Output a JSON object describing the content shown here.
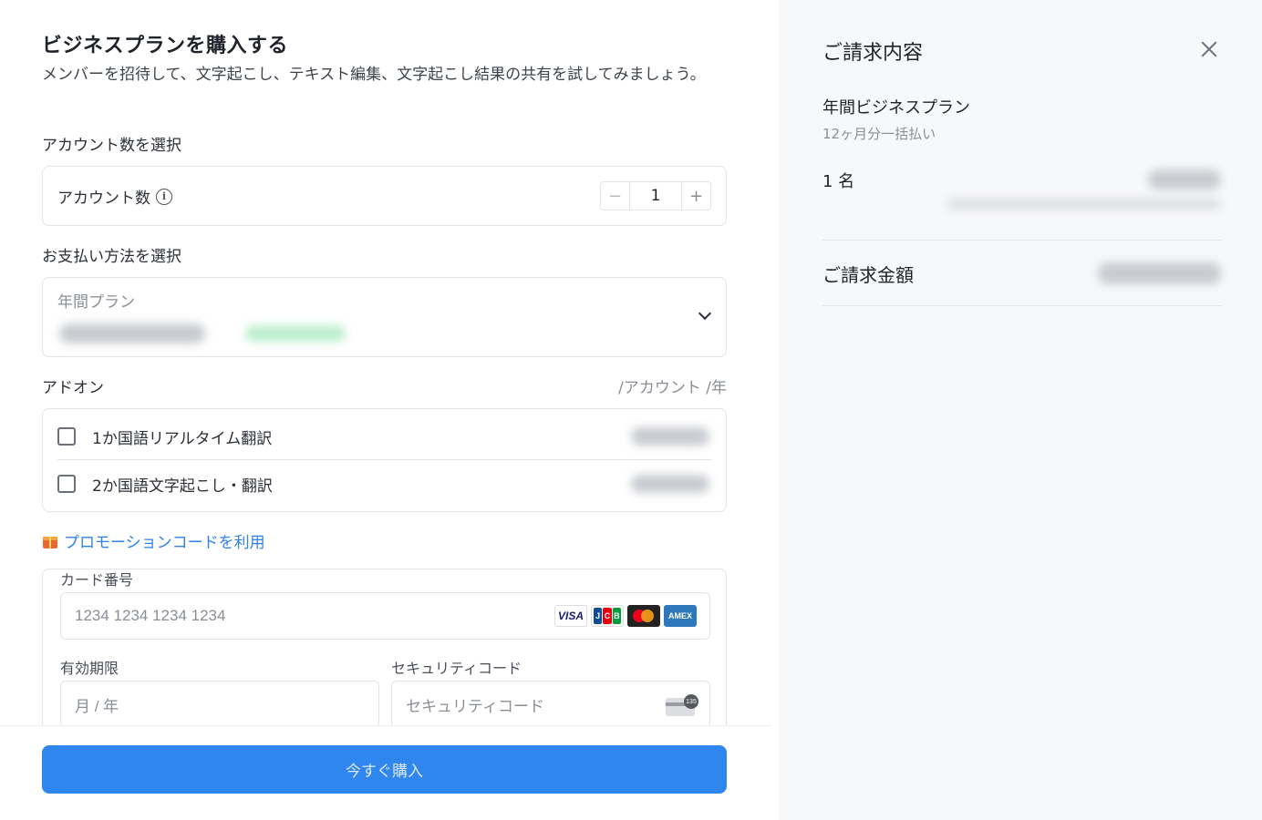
{
  "checkout": {
    "title": "ビジネスプランを購入する",
    "subtitle": "メンバーを招待して、文字起こし、テキスト編集、文字起こし結果の共有を試してみましょう。",
    "accounts": {
      "section_label": "アカウント数を選択",
      "row_label": "アカウント数",
      "info_icon_glyph": "i",
      "minus": "−",
      "plus": "+",
      "value": "1"
    },
    "payment": {
      "section_label": "お支払い方法を選択",
      "selected_plan": "年間プラン"
    },
    "addons": {
      "section_label": "アドオン",
      "unit_label": "/アカウント /年",
      "items": [
        {
          "label": "1か国語リアルタイム翻訳",
          "checked": false
        },
        {
          "label": "2か国語文字起こし・翻訳",
          "checked": false
        }
      ]
    },
    "promo_label": "プロモーションコードを利用",
    "card": {
      "number_label": "カード番号",
      "number_placeholder": "1234 1234 1234 1234",
      "expiry_label": "有効期限",
      "expiry_placeholder": "月 / 年",
      "cvc_label": "セキュリティコード",
      "cvc_placeholder": "セキュリティコード",
      "brands": [
        "VISA",
        "JCB",
        "Mastercard",
        "AMEX"
      ],
      "cvc_icon_number": "135"
    },
    "buy_button": "今すぐ購入"
  },
  "summary": {
    "title": "ご請求内容",
    "plan_name": "年間ビジネスプラン",
    "plan_billing": "12ヶ月分一括払い",
    "quantity": "1 名",
    "total_label": "ご請求金額"
  },
  "colors": {
    "accent": "#2f86ef",
    "link": "#2f80ed",
    "panel_bg": "#f7f8fa"
  }
}
